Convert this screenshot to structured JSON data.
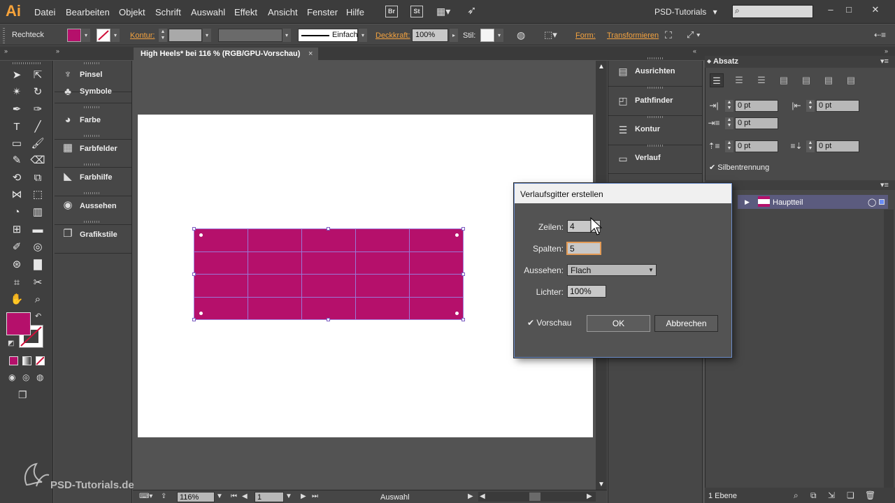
{
  "app": {
    "logo": "Ai",
    "workspace": "PSD-Tutorials",
    "workspace_arrow": "▾"
  },
  "menu": [
    "Datei",
    "Bearbeiten",
    "Objekt",
    "Schrift",
    "Auswahl",
    "Effekt",
    "Ansicht",
    "Fenster",
    "Hilfe"
  ],
  "menubar_icons": {
    "bridge": "Br",
    "stock": "St"
  },
  "window_controls": {
    "minimize": "–",
    "maximize": "□",
    "close": "✕"
  },
  "control_bar": {
    "tool_name": "Rechteck",
    "kontur_label": "Kontur:",
    "stroke_style": "Einfach",
    "deckkraft_label": "Deckkraft:",
    "deckkraft_value": "100%",
    "stil_label": "Stil:",
    "form_label": "Form:",
    "transformieren_label": "Transformieren"
  },
  "document": {
    "tab_title": "High Heels* bei 116 % (RGB/GPU-Vorschau)",
    "close": "×"
  },
  "status_bar": {
    "zoom": "116%",
    "page": "1",
    "status": "Auswahl"
  },
  "icon_panels": [
    {
      "label": "Pinsel",
      "icon": "brush-icon",
      "glyph": "♆"
    },
    {
      "label": "Symbole",
      "icon": "symbols-icon",
      "glyph": "♣"
    },
    {
      "label": "Farbe",
      "icon": "color-icon",
      "glyph": "◕"
    },
    {
      "label": "Farbfelder",
      "icon": "swatches-icon",
      "glyph": "▦"
    },
    {
      "label": "Farbhilfe",
      "icon": "color-guide-icon",
      "glyph": "◣"
    },
    {
      "label": "Aussehen",
      "icon": "appearance-icon",
      "glyph": "◉"
    },
    {
      "label": "Grafikstile",
      "icon": "graphic-styles-icon",
      "glyph": "❐"
    }
  ],
  "right_panels": [
    {
      "label": "Ausrichten",
      "icon": "align-icon",
      "glyph": "▤"
    },
    {
      "label": "Pathfinder",
      "icon": "pathfinder-icon",
      "glyph": "◰"
    },
    {
      "label": "Kontur",
      "icon": "stroke-icon",
      "glyph": "☰"
    },
    {
      "label": "Verlauf",
      "icon": "gradient-icon",
      "glyph": "▭"
    }
  ],
  "absatz": {
    "title": "Absatz",
    "left_indent": "0 pt",
    "right_indent": "0 pt",
    "first_line_indent": "0 pt",
    "space_before": "0 pt",
    "space_after": "0 pt",
    "hyphenation_label": "Silbentrennung",
    "hyphenation_checked": true
  },
  "ebenen": {
    "layer_name": "Hauptteil",
    "layer_count": "1 Ebene"
  },
  "dialog": {
    "title": "Verlaufsgitter erstellen",
    "zeilen_label": "Zeilen:",
    "zeilen_value": "4",
    "spalten_label": "Spalten:",
    "spalten_value": "5",
    "aussehen_label": "Aussehen:",
    "aussehen_value": "Flach",
    "lichter_label": "Lichter:",
    "lichter_value": "100%",
    "vorschau_label": "Vorschau",
    "vorschau_checked": true,
    "ok_label": "OK",
    "cancel_label": "Abbrechen"
  },
  "colors": {
    "fill": "#b5106b",
    "mesh_lines": "#9a77d6",
    "accent_link": "#f3a23f",
    "layer_row": "#5b5b7e"
  },
  "watermark": "PSD-Tutorials.de"
}
